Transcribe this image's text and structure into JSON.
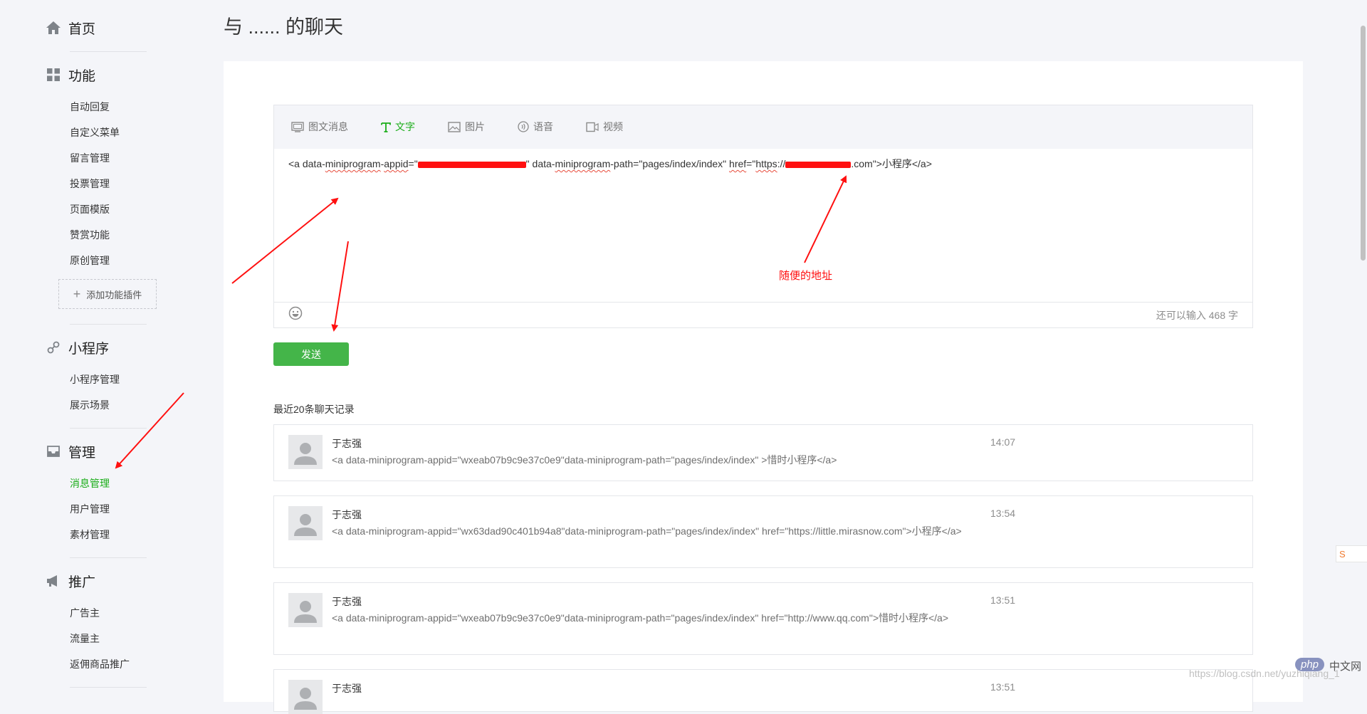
{
  "page": {
    "title": "与 ...... 的聊天"
  },
  "sidebar": {
    "home": "首页",
    "function": {
      "title": "功能",
      "items": [
        "自动回复",
        "自定义菜单",
        "留言管理",
        "投票管理",
        "页面模版",
        "赞赏功能",
        "原创管理"
      ],
      "add_plugin": "添加功能插件"
    },
    "miniprogram": {
      "title": "小程序",
      "items": [
        "小程序管理",
        "展示场景"
      ]
    },
    "manage": {
      "title": "管理",
      "items": [
        "消息管理",
        "用户管理",
        "素材管理"
      ],
      "active_index": 0
    },
    "promote": {
      "title": "推广",
      "items": [
        "广告主",
        "流量主",
        "返佣商品推广"
      ]
    }
  },
  "editor": {
    "tabs": [
      "图文消息",
      "文字",
      "图片",
      "语音",
      "视频"
    ],
    "active_tab": "文字",
    "content": {
      "p1": "<a data-",
      "p2": "miniprogram",
      "p3": "-",
      "p4": "appid",
      "p5": "=\"",
      "p6": "\" data-",
      "p7": "miniprogram",
      "p8": "-path=\"pages/index/index\"  ",
      "p9": "href",
      "p10": "=\"",
      "p11": "https",
      "p12": "://",
      "p13": ".com",
      "p14": "\">小程序</a>"
    },
    "counter": "还可以输入 468 字"
  },
  "send_button": "发送",
  "history": {
    "title": "最近20条聊天记录",
    "messages": [
      {
        "sender": "于志强",
        "time": "14:07",
        "content": "<a data-miniprogram-appid=\"wxeab07b9c9e37c0e9\"data-miniprogram-path=\"pages/index/index\" >惜时小程序</a>"
      },
      {
        "sender": "于志强",
        "time": "13:54",
        "content": "<a data-miniprogram-appid=\"wx63dad90c401b94a8\"data-miniprogram-path=\"pages/index/index\" href=\"https://little.mirasnow.com\">小程序</a>"
      },
      {
        "sender": "于志强",
        "time": "13:51",
        "content": "<a data-miniprogram-appid=\"wxeab07b9c9e37c0e9\"data-miniprogram-path=\"pages/index/index\" href=\"http://www.qq.com\">惜时小程序</a>"
      },
      {
        "sender": "于志强",
        "time": "13:51",
        "content": ""
      }
    ]
  },
  "annotation": {
    "label": "随便的地址",
    "color": "#ff1010"
  },
  "watermark": "https://blog.csdn.net/yuzhiqiang_1",
  "php_logo": "php",
  "php_cn": "中文网",
  "side_widget": "S",
  "colors": {
    "accent": "#1aad19",
    "button": "#44b549",
    "annotation": "#ff1010"
  }
}
